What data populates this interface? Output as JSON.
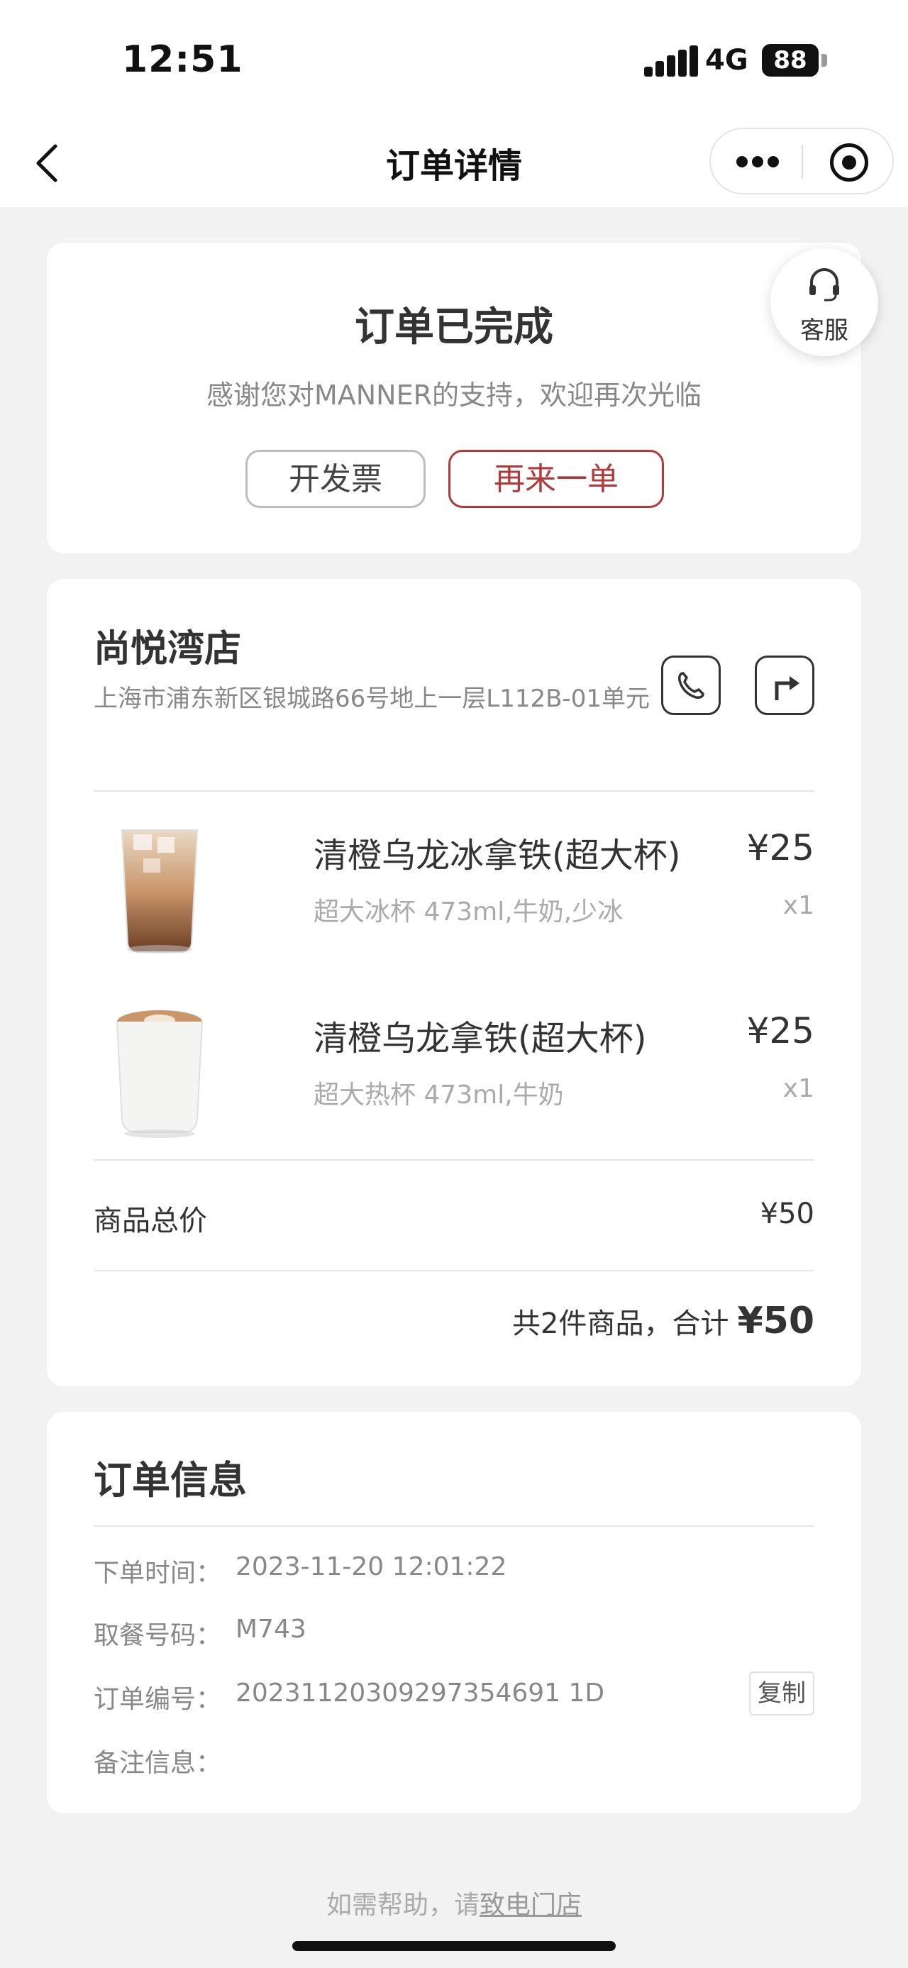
{
  "status_bar": {
    "time": "12:51",
    "network": "4G",
    "battery": "88"
  },
  "nav": {
    "title": "订单详情"
  },
  "status": {
    "title": "订单已完成",
    "subtitle": "感谢您对MANNER的支持，欢迎再次光临",
    "invoice_label": "开发票",
    "reorder_label": "再来一单"
  },
  "customer_service": {
    "label": "客服"
  },
  "store": {
    "name": "尚悦湾店",
    "address": "上海市浦东新区银城路66号地上一层L112B-01单元"
  },
  "items": [
    {
      "name": "清橙乌龙冰拿铁(超大杯)",
      "spec": "超大冰杯 473ml,牛奶,少冰",
      "price": "¥25",
      "qty": "x1",
      "image": "iced-latte-glass"
    },
    {
      "name": "清橙乌龙拿铁(超大杯)",
      "spec": "超大热杯 473ml,牛奶",
      "price": "¥25",
      "qty": "x1",
      "image": "hot-latte-cup"
    }
  ],
  "summary": {
    "subtotal_label": "商品总价",
    "subtotal_value": "¥50",
    "total_prefix": "共2件商品，合计",
    "total_value": "¥50"
  },
  "order_info": {
    "title": "订单信息",
    "rows": [
      {
        "label": "下单时间：",
        "value": "2023-11-20 12:01:22"
      },
      {
        "label": "取餐号码：",
        "value": "M743"
      },
      {
        "label": "订单编号：",
        "value": "20231120309297354691 1D"
      },
      {
        "label": "备注信息：",
        "value": ""
      }
    ],
    "copy_label": "复制"
  },
  "footer": {
    "prefix": "如需帮助，请",
    "link": "致电门店"
  },
  "colors": {
    "accent": "#b33a3a",
    "background": "#f2f2f2"
  }
}
